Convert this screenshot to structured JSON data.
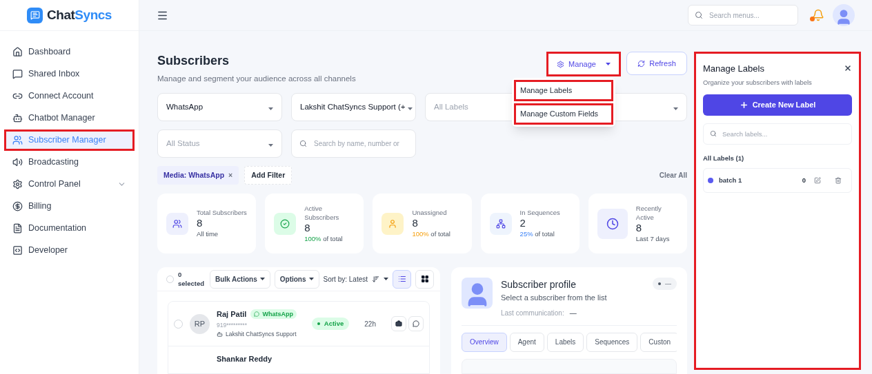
{
  "brand": {
    "text": "Chat",
    "accent": "Syncs"
  },
  "sidebar": {
    "items": [
      {
        "label": "Dashboard",
        "selected": false,
        "highlighted": false,
        "kind": "link"
      },
      {
        "label": "Shared Inbox",
        "selected": false,
        "highlighted": false,
        "kind": "link"
      },
      {
        "label": "Connect Account",
        "selected": false,
        "highlighted": false,
        "kind": "link"
      },
      {
        "label": "Chatbot Manager",
        "selected": false,
        "highlighted": false,
        "kind": "link"
      },
      {
        "label": "Subscriber Manager",
        "selected": true,
        "highlighted": true,
        "kind": "link"
      },
      {
        "label": "Broadcasting",
        "selected": false,
        "highlighted": false,
        "kind": "link"
      },
      {
        "label": "Control Panel",
        "selected": false,
        "highlighted": false,
        "kind": "group"
      },
      {
        "label": "Billing",
        "selected": false,
        "highlighted": false,
        "kind": "link"
      },
      {
        "label": "Documentation",
        "selected": false,
        "highlighted": false,
        "kind": "link"
      },
      {
        "label": "Developer",
        "selected": false,
        "highlighted": false,
        "kind": "link"
      }
    ]
  },
  "header": {
    "search": {
      "placeholder": "Search menus..."
    }
  },
  "page": {
    "title": "Subscribers",
    "subtitle": "Manage and segment your audience across all channels"
  },
  "actions": {
    "manage": {
      "label": "Manage",
      "highlighted": true
    },
    "refresh": {
      "label": "Refresh"
    }
  },
  "manage_menu": [
    {
      "label": "Manage Labels",
      "highlighted": true
    },
    {
      "label": "Manage Custom Fields",
      "highlighted": true
    }
  ],
  "filters": [
    {
      "kind": "select",
      "value": "WhatsApp"
    },
    {
      "kind": "select",
      "value": "Lakshit ChatSyncs Support (+"
    },
    {
      "kind": "select",
      "placeholder": "All Labels"
    },
    {
      "kind": "select",
      "placeholder": "All Status"
    },
    {
      "kind": "search",
      "placeholder": "Search by name, number or"
    }
  ],
  "active_filters": [
    {
      "label": "Media: WhatsApp",
      "remove": "×"
    }
  ],
  "add_filter": "Add Filter",
  "clear_all": "Clear All",
  "stats": [
    {
      "label": "Total Subscribers",
      "value": "8",
      "note": "All time",
      "color": "#eef0fd"
    },
    {
      "label": "Active Subscribers",
      "value": "8",
      "accent": "100%",
      "note": "of total",
      "color": "#dcfce7"
    },
    {
      "label": "Unassigned",
      "value": "8",
      "accent": "100%",
      "note": "of total",
      "color": "#fef3c7"
    },
    {
      "label": "In Sequences",
      "value": "2",
      "accent": "25%",
      "note": "of total",
      "color": "#eef4fd"
    },
    {
      "label": "Recently Active",
      "value": "8",
      "note": "Last 7 days",
      "color": "#eef0fd"
    }
  ],
  "list": {
    "selected_count": "0 selected",
    "select_all": false,
    "bulk": "Bulk Actions",
    "options": "Options",
    "sort": "Sort by: Latest",
    "views": [
      {
        "kind": "list",
        "selected": true
      },
      {
        "kind": "grid",
        "selected": false
      }
    ],
    "rows": [
      {
        "name": "Raj Patil",
        "channel": "WhatsApp",
        "initials": "RP",
        "phone": "919*********",
        "account": "Lakshit ChatSyncs Support",
        "status": "Active",
        "time": "22h",
        "checked": false
      },
      {
        "name": "Shankar Reddy"
      }
    ]
  },
  "profile": {
    "title": "Subscriber profile",
    "subtitle": "Select a subscriber from the list",
    "last_label": "Last communication:",
    "last_value": "—",
    "status": "—",
    "tabs": [
      {
        "label": "Overview",
        "selected": true
      },
      {
        "label": "Agent",
        "selected": false
      },
      {
        "label": "Labels",
        "selected": false
      },
      {
        "label": "Sequences",
        "selected": false
      },
      {
        "label": "Custon",
        "selected": false
      }
    ]
  },
  "labels_panel": {
    "highlighted": true,
    "title": "Manage Labels",
    "subtitle": "Organize your subscribers with labels",
    "create": "Create New Label",
    "search_placeholder": "Search labels...",
    "section": "All Labels (1)",
    "labels": [
      {
        "name": "batch 1",
        "count": "0",
        "color": "#5b5bf0"
      }
    ]
  }
}
